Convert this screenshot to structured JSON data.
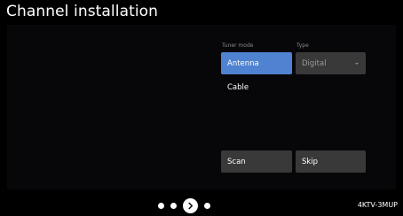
{
  "header": {
    "title": "Channel installation"
  },
  "tuner_mode": {
    "label": "Tuner mode",
    "options": [
      {
        "label": "Antenna",
        "selected": true
      },
      {
        "label": "Cable",
        "selected": false
      }
    ]
  },
  "type": {
    "label": "Type",
    "value": "Digital"
  },
  "buttons": {
    "scan": "Scan",
    "skip": "Skip"
  },
  "footer": {
    "model": "4KTV-3MUP"
  },
  "colors": {
    "selected": "#4f83d1",
    "button_bg": "#393939",
    "background": "#000000"
  },
  "icons": {
    "next": "chevron-right-icon"
  }
}
